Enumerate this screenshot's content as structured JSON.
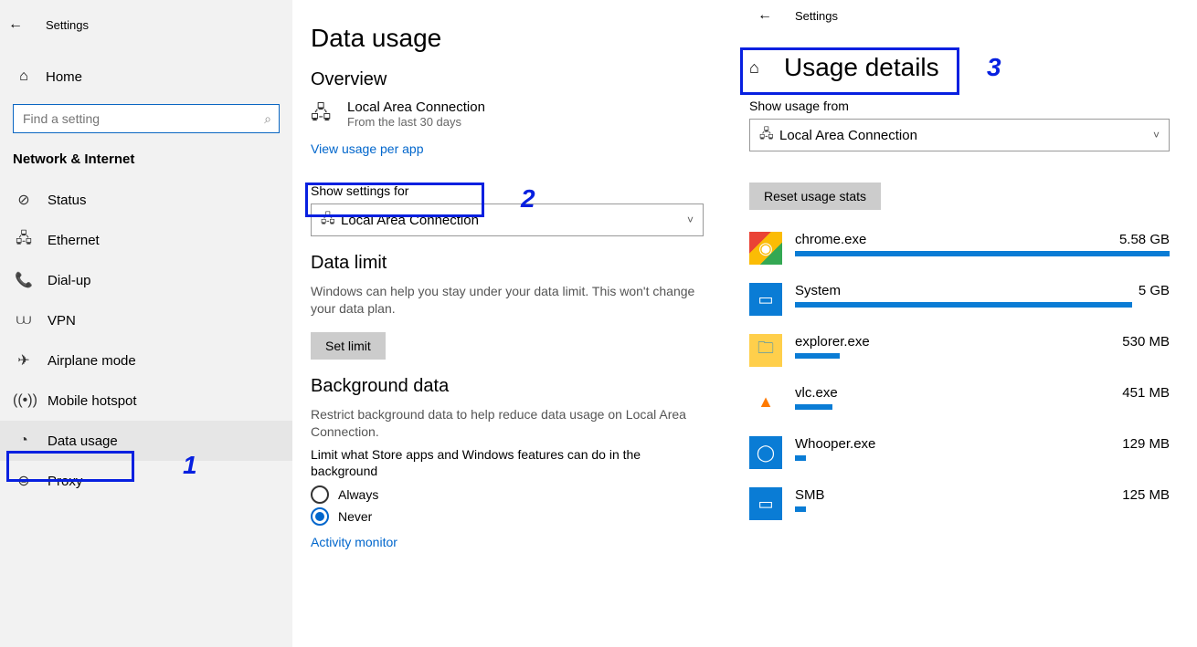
{
  "left": {
    "top_label": "Settings",
    "home_label": "Home",
    "search_placeholder": "Find a setting",
    "category": "Network & Internet",
    "items": [
      {
        "icon": "⊘",
        "label": "Status"
      },
      {
        "icon": "🖧",
        "label": "Ethernet"
      },
      {
        "icon": "📞",
        "label": "Dial-up"
      },
      {
        "icon": "⩊",
        "label": "VPN"
      },
      {
        "icon": "✈",
        "label": "Airplane mode"
      },
      {
        "icon": "((•))",
        "label": "Mobile hotspot"
      },
      {
        "icon": "◔",
        "label": "Data usage"
      },
      {
        "icon": "⊜",
        "label": "Proxy"
      }
    ]
  },
  "mid": {
    "title": "Data usage",
    "overview_h": "Overview",
    "conn_name": "Local Area Connection",
    "conn_sub": "From the last 30 days",
    "view_per_app": "View usage per app",
    "show_settings_for": "Show settings for",
    "combo_value": "Local Area Connection",
    "data_limit_h": "Data limit",
    "data_limit_desc": "Windows can help you stay under your data limit. This won't change your data plan.",
    "set_limit_btn": "Set limit",
    "bg_h": "Background data",
    "bg_desc": "Restrict background data to help reduce data usage on Local Area Connection.",
    "bg_limit_desc": "Limit what Store apps and Windows features can do in the background",
    "radio_always": "Always",
    "radio_never": "Never",
    "activity_monitor": "Activity monitor"
  },
  "right": {
    "top_label": "Settings",
    "title": "Usage details",
    "show_from_label": "Show usage from",
    "combo_value": "Local Area Connection",
    "reset_btn": "Reset usage stats",
    "apps": [
      {
        "name": "chrome.exe",
        "usage": "5.58 GB",
        "pct": 100,
        "color": "#fff",
        "bg": "linear-gradient(135deg,#ea4335 0 33%,#fbbc05 33% 66%,#34a853 66% 100%)",
        "glyph": "◉"
      },
      {
        "name": "System",
        "usage": "5 GB",
        "pct": 90,
        "color": "#fff",
        "bg": "#0a7cd5",
        "glyph": "▭"
      },
      {
        "name": "explorer.exe",
        "usage": "530 MB",
        "pct": 12,
        "color": "#0a7cd5",
        "bg": "#ffcf4b",
        "glyph": "🗀"
      },
      {
        "name": "vlc.exe",
        "usage": "451 MB",
        "pct": 10,
        "color": "#ff7a00",
        "bg": "#fff",
        "glyph": "▲"
      },
      {
        "name": "Whooper.exe",
        "usage": "129 MB",
        "pct": 3,
        "color": "#fff",
        "bg": "#0a7cd5",
        "glyph": "◯"
      },
      {
        "name": "SMB",
        "usage": "125 MB",
        "pct": 3,
        "color": "#fff",
        "bg": "#0a7cd5",
        "glyph": "▭"
      }
    ]
  },
  "annotations": {
    "n1": "1",
    "n2": "2",
    "n3": "3"
  }
}
